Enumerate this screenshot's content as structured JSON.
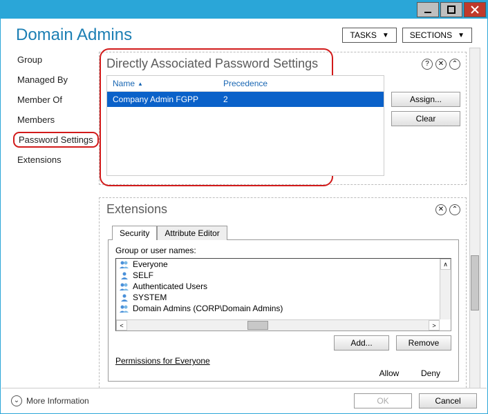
{
  "header": {
    "title": "Domain Admins",
    "tasks_label": "TASKS",
    "sections_label": "SECTIONS"
  },
  "sidebar": {
    "items": [
      {
        "label": "Group"
      },
      {
        "label": "Managed By"
      },
      {
        "label": "Member Of"
      },
      {
        "label": "Members"
      },
      {
        "label": "Password Settings"
      },
      {
        "label": "Extensions"
      }
    ]
  },
  "password_section": {
    "title": "Directly Associated Password Settings",
    "col_name": "Name",
    "col_precedence": "Precedence",
    "rows": [
      {
        "name": "Company Admin FGPP",
        "precedence": "2"
      }
    ],
    "assign_label": "Assign...",
    "clear_label": "Clear"
  },
  "extensions_section": {
    "title": "Extensions",
    "tab_security": "Security",
    "tab_attr": "Attribute Editor",
    "group_label": "Group or user names:",
    "groups": [
      "Everyone",
      "SELF",
      "Authenticated Users",
      "SYSTEM",
      "Domain Admins (CORP\\Domain Admins)"
    ],
    "add_label": "Add...",
    "remove_label": "Remove",
    "perm_label": "Permissions for Everyone",
    "allow_label": "Allow",
    "deny_label": "Deny"
  },
  "footer": {
    "more": "More Information",
    "ok": "OK",
    "cancel": "Cancel"
  },
  "icons": {
    "help": "?",
    "close": "✕",
    "collapse": "⌃",
    "expand_down": "⌄"
  }
}
